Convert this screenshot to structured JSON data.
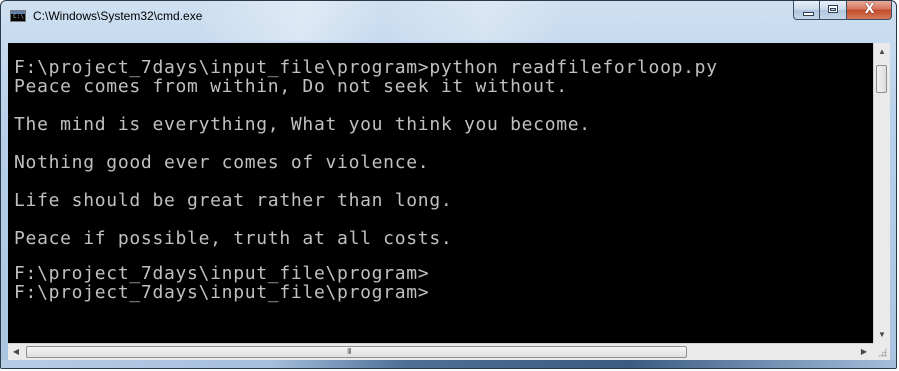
{
  "window": {
    "title": "C:\\Windows\\System32\\cmd.exe",
    "icon": "cmd-icon",
    "icon_text": "C:\\"
  },
  "controls": {
    "minimize_icon": "minimize-icon",
    "maximize_icon": "maximize-icon",
    "close_icon": "close-icon",
    "close_glyph": "X"
  },
  "console": {
    "background": "#000000",
    "foreground": "#c0c0c0",
    "lines": [
      "F:\\project_7days\\input_file\\program>python readfileforloop.py",
      "Peace comes from within, Do not seek it without.",
      "",
      "The mind is everything, What you think you become.",
      "",
      "Nothing good ever comes of violence.",
      "",
      "Life should be great rather than long.",
      "",
      "Peace if possible, truth at all costs.",
      "",
      "F:\\project_7days\\input_file\\program>",
      "F:\\project_7days\\input_file\\program>"
    ]
  },
  "scrollbars": {
    "up_arrow": "▲",
    "down_arrow": "▼",
    "left_arrow": "◀",
    "right_arrow": "▶",
    "grip": "III"
  }
}
